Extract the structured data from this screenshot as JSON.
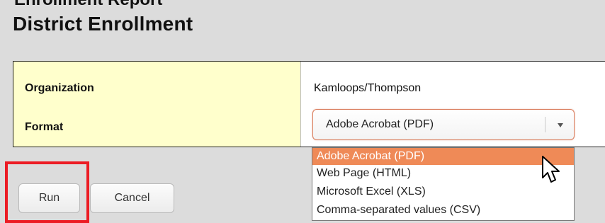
{
  "header": {
    "top_cut_text": "Enrollment Report",
    "title": "District Enrollment"
  },
  "form": {
    "organization_label": "Organization",
    "organization_value": "Kamloops/Thompson",
    "format_label": "Format",
    "format_selected": "Adobe Acrobat (PDF)",
    "format_options": [
      "Adobe Acrobat (PDF)",
      "Web Page (HTML)",
      "Microsoft Excel (XLS)",
      "Comma-separated values (CSV)"
    ]
  },
  "buttons": {
    "run_label": "Run",
    "cancel_label": "Cancel"
  },
  "colors": {
    "label_column_bg": "#ffffcc",
    "selected_option_bg": "#ef8a57",
    "highlight_box": "#ec1c24"
  },
  "icons": {
    "dropdown_arrow": "chevron-down-icon",
    "mouse_pointer": "arrow-cursor-icon"
  }
}
